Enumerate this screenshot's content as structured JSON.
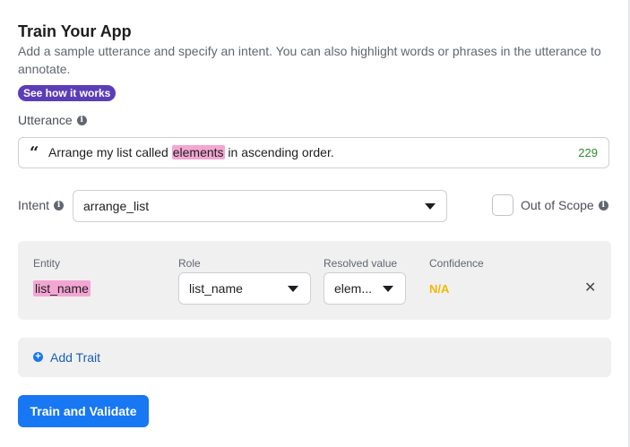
{
  "header": {
    "title": "Train Your App",
    "description": "Add a sample utterance and specify an intent. You can also highlight words or phrases in the utterance to annotate.",
    "see_how_label": "See how it works"
  },
  "utterance": {
    "label": "Utterance",
    "text_before": "Arrange my list called ",
    "highlighted": "elements",
    "text_after": " in ascending order.",
    "char_count": "229",
    "quote_icon": "“"
  },
  "intent": {
    "label": "Intent",
    "value": "arrange_list",
    "out_of_scope_label": "Out of Scope",
    "out_of_scope_checked": false
  },
  "entity_table": {
    "headers": {
      "entity": "Entity",
      "role": "Role",
      "resolved": "Resolved value",
      "confidence": "Confidence"
    },
    "row": {
      "entity": "list_name",
      "role": "list_name",
      "resolved": "elem...",
      "confidence": "N/A"
    }
  },
  "trait": {
    "add_label": "Add Trait"
  },
  "actions": {
    "train_label": "Train and Validate"
  },
  "colors": {
    "accent": "#1877f2",
    "badge": "#5b3db8",
    "highlight": "#f4a6d2",
    "count": "#2e8b2e",
    "confidence_na": "#f5b700"
  },
  "icons": {
    "info": "info-icon",
    "quote": "quote-icon",
    "caret": "chevron-down-icon",
    "close": "close-icon",
    "add": "plus-circle-icon"
  }
}
